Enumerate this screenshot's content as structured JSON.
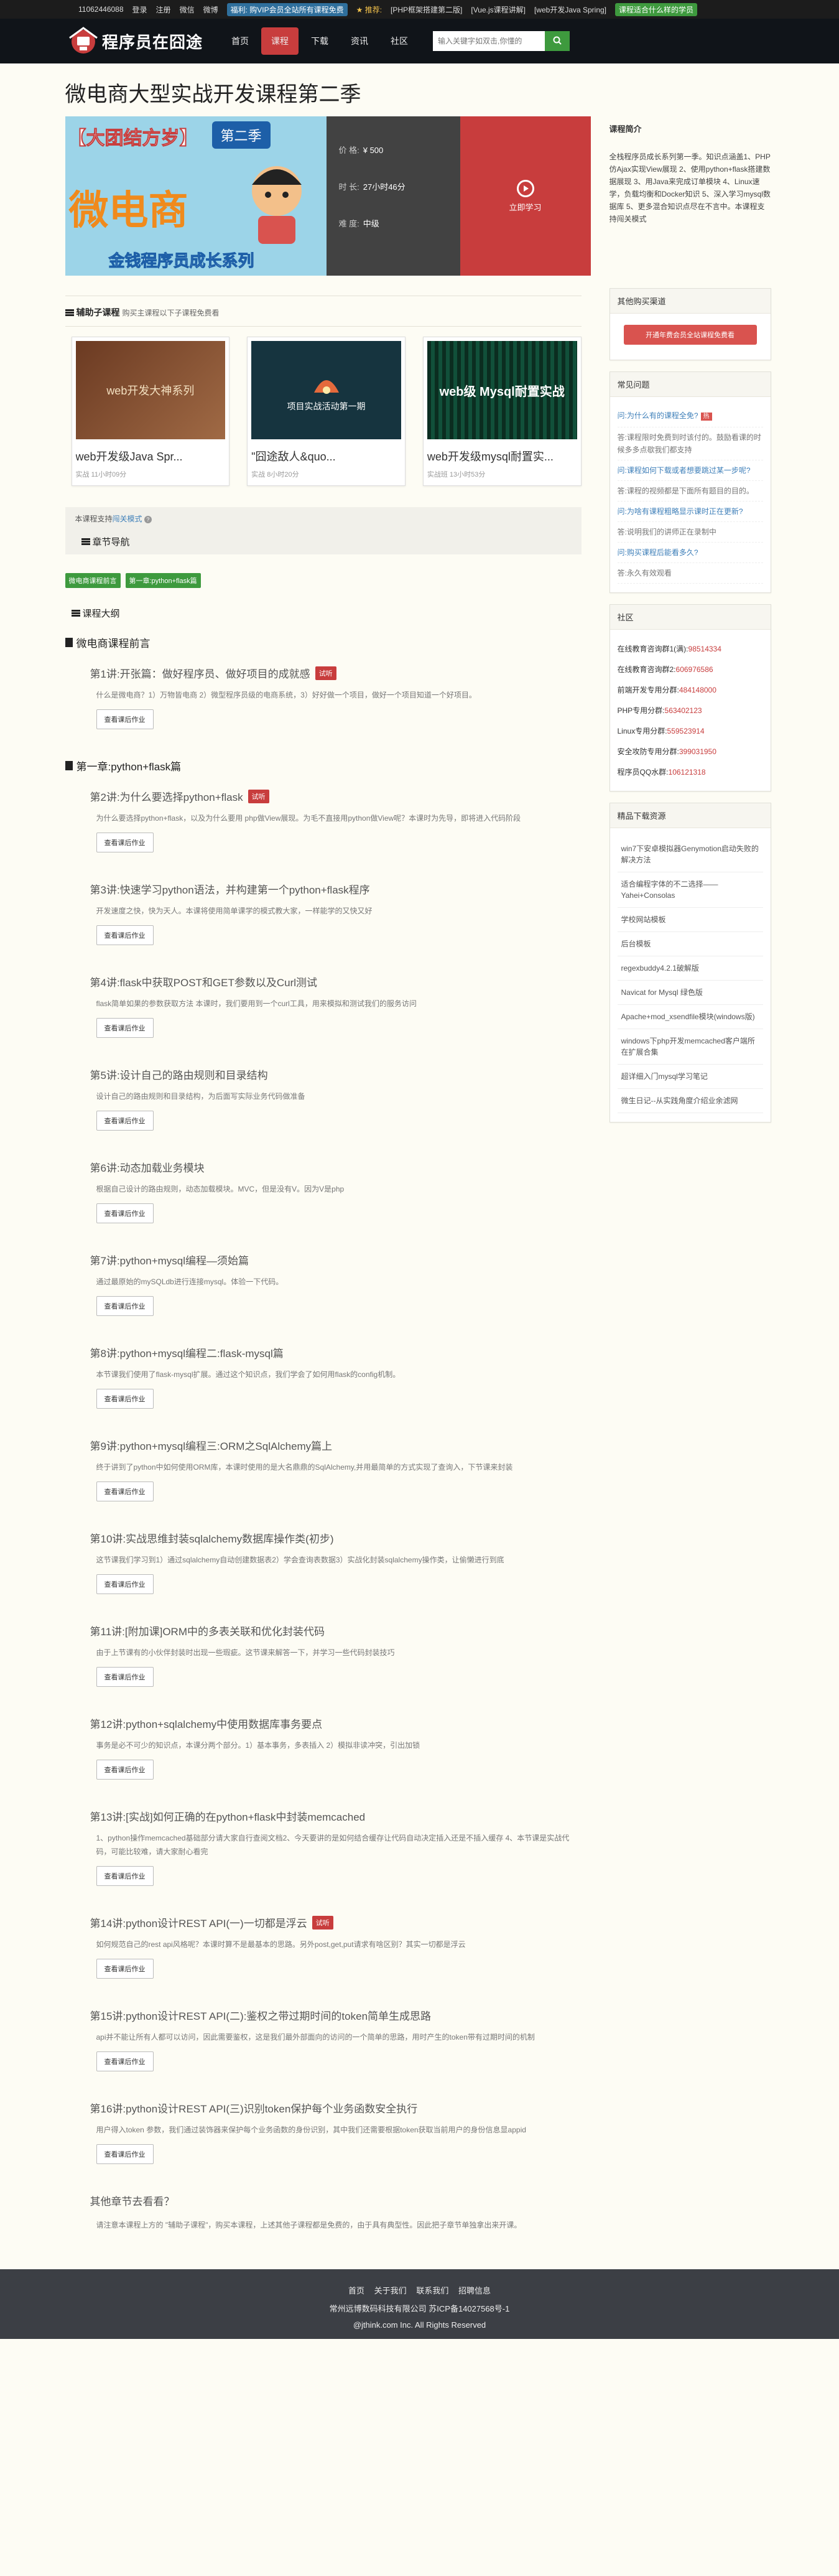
{
  "topbar": {
    "phone": "11062446088",
    "qq": "",
    "login": "登录",
    "register": "注册",
    "weixin": "微信",
    "weibo": "微博",
    "vip_link": "福利: 购VIP会员全站所有课程免费",
    "hot": "★ 推荐:",
    "link1": "[PHP框架搭建第二版]",
    "link2": "[Vue.js课程讲解]",
    "link3": "[web开发Java Spring]",
    "right": "课程适合什么样的学员"
  },
  "header": {
    "logo_text": "程序员在囧途",
    "nav": [
      "首页",
      "课程",
      "下载",
      "资讯",
      "社区"
    ],
    "search_placeholder": "输入关键字如双击,你懂的"
  },
  "course": {
    "title": "微电商大型实战开发课程第二季",
    "price_label": "价 格:",
    "price": "¥ 500",
    "duration_label": "时 长:",
    "duration": "27小时46分",
    "level_label": "难 度:",
    "level": "中级",
    "cta": "立即学习",
    "banner_top": "【大团结方岁】",
    "banner_badge": "第二季",
    "banner_title": "微电商",
    "banner_sub": "金钱程序员成长系列",
    "intro_title": "课程简介",
    "intro": "全栈程序员成长系列第一季。知识点涵盖1、PHP仿Ajax实现View展现 2、使用python+flask搭建数据展现 3、用Java来完成订单模块 4、Linux速学，负载均衡和Docker知识 5、深入学习mysql数据库 5、更多混合知识点尽在不言中。本课程支持闯关模式"
  },
  "aux": {
    "title": "辅助子课程",
    "subtitle": "购买主课程以下子课程免费看",
    "cards": [
      {
        "title": "web开发级Java Spr...",
        "meta": "实战 11小时09分",
        "img_text": "web开发大神系列"
      },
      {
        "title": "\"囧途敌人&quo...",
        "meta": "实战 8小时20分",
        "img_text": "项目实战活动第一期"
      },
      {
        "title": "web开发级mysql耐置实...",
        "meta": "实战班 13小时53分",
        "img_text": "web级 Mysql耐置实战"
      }
    ]
  },
  "chapters": {
    "note_prefix": "本课程支持",
    "note_link": "闯关模式",
    "nav_title": "章节导航",
    "chips": [
      "微电商课程前言",
      "第一章:python+flask篇"
    ],
    "outline_title": "课程大纲",
    "hw": "查看课后作业",
    "free": "试听",
    "ch0": "微电商课程前言",
    "l1": {
      "title": "第1讲:开张篇：做好程序员、做好项目的成就感",
      "desc": "什么是微电商？1）万物皆电商 2）微型程序员级的电商系统，3）好好做一个项目，做好一个项目知道一个好项目。"
    },
    "ch1": "第一章:python+flask篇",
    "lessons": [
      {
        "title": "第2讲:为什么要选择python+flask",
        "badge": true,
        "desc": "为什么要选择python+flask，以及为什么要用 php做View展现。为毛不直接用python做View呢？本课时为先导，即将进入代码阶段"
      },
      {
        "title": "第3讲:快速学习python语法，并构建第一个python+flask程序",
        "badge": false,
        "desc": "开发速度之快，快为天人。本课将使用简单课学的模式教大家，一样能学的又快又好"
      },
      {
        "title": "第4讲:flask中获取POST和GET参数以及Curl测试",
        "badge": false,
        "desc": "flask简单如果的参数获取方法 本课时，我们要用到一个curl工具，用来模拟和测试我们的服务访问"
      },
      {
        "title": "第5讲:设计自己的路由规则和目录结构",
        "badge": false,
        "desc": "设计自己的路由规则和目录结构，为后面写实际业务代码做准备"
      },
      {
        "title": "第6讲:动态加载业务模块",
        "badge": false,
        "desc": "根据自己设计的路由规则，动态加载模块。MVC，但是没有V。因为V是php"
      },
      {
        "title": "第7讲:python+mysql编程—须始篇",
        "badge": false,
        "desc": "通过最原始的mySQLdb进行连接mysql。体验一下代码。"
      },
      {
        "title": "第8讲:python+mysql编程二:flask-mysql篇",
        "badge": false,
        "desc": "本节课我们使用了flask-mysql扩展。通过这个知识点，我们学会了如何用flask的config机制。"
      },
      {
        "title": "第9讲:python+mysql编程三:ORM之SqlAlchemy篇上",
        "badge": false,
        "desc": "终于讲到了python中如何使用ORM库，本课时使用的是大名鼎鼎的SqlAlchemy,并用最简单的方式实现了查询入，下节课来封装"
      },
      {
        "title": "第10讲:实战思维封装sqlalchemy数据库操作类(初步)",
        "badge": false,
        "desc": "这节课我们学习到1）通过sqlalchemy自动创建数据表2）学会查询表数据3）实战化封装sqlalchemy操作类，让偷懒进行到底"
      },
      {
        "title": "第11讲:[附加课]ORM中的多表关联和优化封装代码",
        "badge": false,
        "desc": "由于上节课有的小伙伴封装时出现一些瑕疵。这节课来解答一下，并学习一些代码封装技巧"
      },
      {
        "title": "第12讲:python+sqlalchemy中使用数据库事务要点",
        "badge": false,
        "desc": "事务是必不可少的知识点，本课分两个部分。1）基本事务，多表插入 2）模拟非读冲突，引出加锁"
      },
      {
        "title": "第13讲:[实战]如何正确的在python+flask中封装memcached",
        "badge": false,
        "desc": "1、python操作memcached基础部分请大家自行查阅文档2、今天要讲的是如何结合缓存让代码自动决定插入还是不插入缓存 4、本节课是实战代码，可能比较难，请大家耐心看完"
      },
      {
        "title": "第14讲:python设计REST API(一)一切都是浮云",
        "badge": true,
        "desc": "如何规范自己的rest api风格呢？本课时算不是最基本的思路。另外post,get,put请求有啥区别？其实一切都是浮云"
      },
      {
        "title": "第15讲:python设计REST API(二):鉴权之带过期时间的token简单生成思路",
        "badge": false,
        "desc": "api并不能让所有人都可以访问，因此需要鉴权，这是我们最外部面向的访问的一个简单的思路，用时产生的token带有过期时间的机制"
      },
      {
        "title": "第16讲:python设计REST API(三)识别token保护每个业务函数安全执行",
        "badge": false,
        "desc": "用户得入token 参数，我们通过装饰器来保护每个业务函数的身份识别，其中我们还需要根据token获取当前用户的身份信息显appid"
      }
    ],
    "others_title": "其他章节去看看？",
    "others_desc": "请注意本课程上方的 \"辅助子课程\"，购买本课程，上述其他子课程都是免费的，由于具有典型性。因此把子章节单独拿出来开课。"
  },
  "sidebar": {
    "buy_title": "其他购买渠道",
    "buy_btn": "开通年费会员全站课程免费看",
    "faq_title": "常见问题",
    "faq": [
      {
        "text": "问:为什么有的课程全免?",
        "link": true,
        "tag": "热"
      },
      {
        "text": "答:课程限时免费到时该付的。鼓励看课的时候多多点歇我们都支持",
        "link": false,
        "tag": ""
      },
      {
        "text": "问:课程如何下载或者想要跳过某一步呢?",
        "link": true,
        "tag": ""
      },
      {
        "text": "答:课程的视频都是下面所有题目的目的。",
        "link": false,
        "tag": ""
      },
      {
        "text": "问:为啥有课程粗略显示课时正在更新?",
        "link": true,
        "tag": ""
      },
      {
        "text": "答:说明我们的讲师正在录制中",
        "link": false,
        "tag": ""
      },
      {
        "text": "问:购买课程后能看多久?",
        "link": true,
        "tag": ""
      },
      {
        "text": "答:永久有效观看",
        "link": false,
        "tag": ""
      }
    ],
    "community_title": "社区",
    "groups": [
      {
        "label": "在线教育咨询群1(满):",
        "num": "98514334"
      },
      {
        "label": "在线教育咨询群2:",
        "num": "606976586"
      },
      {
        "label": "前端开发专用分群:",
        "num": "484148000"
      },
      {
        "label": "PHP专用分群:",
        "num": "563402123"
      },
      {
        "label": "Linux专用分群:",
        "num": "559523914"
      },
      {
        "label": "安全攻防专用分群:",
        "num": "399031950"
      },
      {
        "label": "程序员QQ水群:",
        "num": "106121318"
      }
    ],
    "res_title": "精品下载资源",
    "resources": [
      "win7下安卓模拟器Genymotion启动失败的解决方法",
      "适合编程字体的不二选择——Yahei+Consolas",
      "学校网站模板",
      "后台模板",
      "regexbuddy4.2.1破解版",
      "Navicat for Mysql 绿色版",
      "Apache+mod_xsendfile模块(windows版)",
      "windows下php开发memcached客户端所在扩展合集",
      "超详细入门mysql学习笔记",
      "微生日记--从实践角度介绍业余滤网"
    ]
  },
  "footer": {
    "links": [
      "首页",
      "关于我们",
      "联系我们",
      "招聘信息"
    ],
    "company": "常州远博数码科技有限公司 苏ICP备14027568号-1",
    "copyright": "@jthink.com Inc. All Rights Reserved"
  },
  "colors": {
    "brand_red": "#c83d3d",
    "green": "#3e9a3e",
    "header_bg": "#101419"
  }
}
